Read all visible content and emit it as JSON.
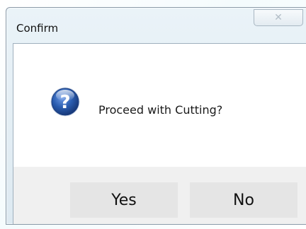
{
  "window": {
    "title": "Confirm",
    "close_glyph": "✕"
  },
  "message": {
    "text": "Proceed with Cutting?",
    "icon": "question-icon"
  },
  "buttons": {
    "yes_label": "Yes",
    "no_label": "No"
  },
  "colors": {
    "icon_blue": "#2a5db0",
    "title_bar": "#dde9f1",
    "button_bg": "#e5e5e5",
    "button_area_bg": "#f0f0f0"
  }
}
